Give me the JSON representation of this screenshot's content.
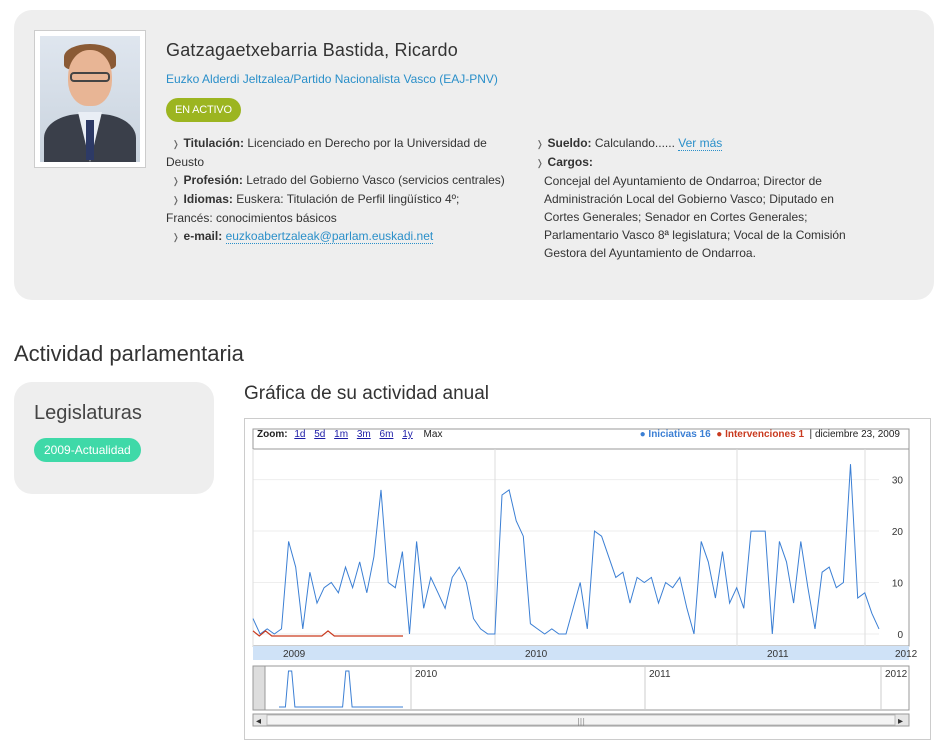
{
  "profile": {
    "name": "Gatzagaetxebarria Bastida, Ricardo",
    "party": "Euzko Alderdi Jeltzalea/Partido Nacionalista Vasco (EAJ-PNV)",
    "status": "EN ACTIVO",
    "titulacion_label": "Titulación:",
    "titulacion_value": "Licenciado en Derecho por la Universidad de",
    "titulacion_value2": "Deusto",
    "profesion_label": "Profesión:",
    "profesion_value": "Letrado del Gobierno Vasco (servicios centrales)",
    "idiomas_label": "Idiomas:",
    "idiomas_value": "Euskera: Titulación de Perfil lingüístico 4º;",
    "idiomas_value2": "Francés: conocimientos básicos",
    "email_label": "e-mail:",
    "email_value": "euzkoabertzaleak@parlam.euskadi.net",
    "sueldo_label": "Sueldo:",
    "sueldo_value": "Calculando......",
    "sueldo_link": "Ver más",
    "cargos_label": "Cargos:",
    "cargos_lines": [
      "Concejal del Ayuntamiento de Ondarroa; Director de",
      "Administración Local del Gobierno Vasco; Diputado en",
      "Cortes Generales; Senador en Cortes Generales;",
      "Parlamentario Vasco 8ª legislatura; Vocal de la Comisión",
      "Gestora del Ayuntamiento de Ondarroa."
    ]
  },
  "activity": {
    "section_title": "Actividad parlamentaria",
    "legislaturas_title": "Legislaturas",
    "legislatura_badge": "2009-Actualidad",
    "chart_title": "Gráfica de su actividad anual"
  },
  "chart_controls": {
    "zoom_label": "Zoom:",
    "zoom_options": [
      "1d",
      "5d",
      "1m",
      "3m",
      "6m",
      "1y"
    ],
    "zoom_max": "Max",
    "legend_iniciativas": "Iniciativas 16",
    "legend_intervenciones": "Intervenciones 1",
    "legend_date": "diciembre 23, 2009"
  },
  "colors": {
    "iniciativas": "#3b7fd4",
    "intervenciones": "#c93a1f",
    "badge_active": "#9cb520",
    "badge_legislatura": "#3fd9a8",
    "link": "#2a8fc9"
  },
  "chart_data": {
    "type": "line",
    "y_ticks": [
      "30",
      "20",
      "10",
      "0"
    ],
    "ylim": [
      0,
      34
    ],
    "x_ticks_main": [
      "2009",
      "2010",
      "2011",
      "2012"
    ],
    "x_ticks_overview": [
      "2010",
      "2011",
      "2012"
    ],
    "series": [
      {
        "name": "Iniciativas 16",
        "values": [
          3,
          0,
          1,
          0,
          1,
          18,
          13,
          1,
          12,
          6,
          9,
          10,
          8,
          13,
          9,
          14,
          8,
          15,
          28,
          10,
          9,
          16,
          0,
          18,
          5,
          11,
          8,
          5,
          11,
          13,
          10,
          3,
          1,
          0,
          0,
          27,
          28,
          22,
          19,
          2,
          1,
          0,
          1,
          0,
          0,
          5,
          10,
          1,
          20,
          19,
          15,
          11,
          12,
          6,
          11,
          10,
          11,
          6,
          10,
          9,
          11,
          5,
          0,
          18,
          14,
          7,
          16,
          6,
          9,
          5,
          20,
          20,
          20,
          0,
          18,
          14,
          6,
          18,
          9,
          1,
          12,
          13,
          9,
          10,
          33,
          7,
          8,
          4,
          1
        ]
      },
      {
        "name": "Intervenciones 1",
        "values": [
          1,
          0,
          1,
          0,
          0,
          0,
          0,
          0,
          0,
          0,
          0,
          0,
          1,
          0,
          0,
          0,
          0,
          0,
          0,
          0,
          0,
          0,
          0,
          0,
          0
        ]
      }
    ]
  }
}
